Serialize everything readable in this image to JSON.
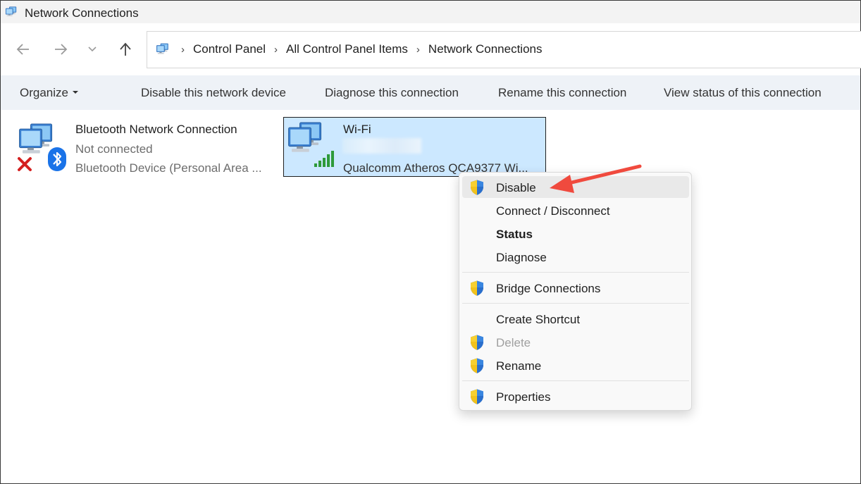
{
  "window": {
    "title": "Network Connections"
  },
  "breadcrumbs": [
    "Control Panel",
    "All Control Panel Items",
    "Network Connections"
  ],
  "commands": {
    "organize": "Organize",
    "disable": "Disable this network device",
    "diagnose": "Diagnose this connection",
    "rename": "Rename this connection",
    "view_status": "View status of this connection"
  },
  "connections": [
    {
      "name": "Bluetooth Network Connection",
      "status": "Not connected",
      "device": "Bluetooth Device (Personal Area ..."
    },
    {
      "name": "Wi-Fi",
      "status": "",
      "device": "Qualcomm Atheros QCA9377 Wi..."
    }
  ],
  "context_menu": {
    "items": [
      {
        "label": "Disable",
        "shield": true,
        "highlighted": true
      },
      {
        "label": "Connect / Disconnect",
        "shield": false
      },
      {
        "label": "Status",
        "shield": false,
        "bold": true
      },
      {
        "label": "Diagnose",
        "shield": false
      },
      {
        "label": "Bridge Connections",
        "shield": true
      },
      {
        "label": "Create Shortcut",
        "shield": false
      },
      {
        "label": "Delete",
        "shield": true,
        "disabled": true
      },
      {
        "label": "Rename",
        "shield": true
      },
      {
        "label": "Properties",
        "shield": true
      }
    ]
  },
  "colors": {
    "selection": "#cce8ff",
    "command_bar": "#eef2f7",
    "annotation_arrow": "#f04a3e"
  },
  "icons": {
    "back": "back-arrow-icon",
    "forward": "forward-arrow-icon",
    "recent": "chevron-down-icon",
    "up": "up-arrow-icon",
    "shield": "uac-shield-icon"
  }
}
